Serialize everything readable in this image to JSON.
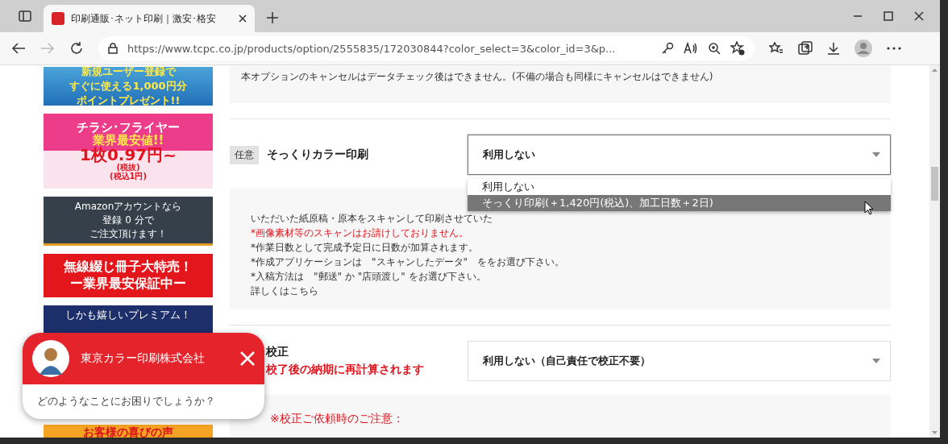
{
  "browser": {
    "tab_title": "印刷通販･ネット印刷｜激安･格安",
    "url": "https://www.tcpc.co.jp/products/option/2555835/172030844?color_select=3&color_id=3&p..."
  },
  "sidebar": {
    "banners": [
      {
        "kind": "points",
        "lines": [
          "新規ユーザー登録で",
          "すぐに使える1,000円分",
          "ポイントプレゼント!!"
        ]
      },
      {
        "kind": "flyer",
        "lines": [
          "チラシ･フライヤー",
          "業界最安値!!",
          "1枚0.97円~",
          "(税抜)",
          "(税込1円)"
        ]
      },
      {
        "kind": "amazon",
        "lines": [
          "Amazonアカウントなら",
          "登録 0 分で",
          "ご注文頂けます！"
        ]
      },
      {
        "kind": "booklet",
        "lines": [
          "無線綴じ冊子大特売！",
          "ー業界最安保証中ー"
        ]
      },
      {
        "kind": "premium",
        "lines": [
          "しかも嬉しいプレミアム！"
        ]
      },
      {
        "kind": "voice",
        "lines": [
          "お客様の喜びの声"
        ]
      }
    ]
  },
  "main": {
    "notice": "本オプションのキャンセルはデータチェック後はできません。(不備の場合も同様にキャンセルはできません)",
    "options": [
      {
        "badge": "任意",
        "label": "そっくりカラー印刷",
        "select": {
          "value": "利用しない",
          "expanded": true,
          "options": [
            {
              "label": "利用しない",
              "highlighted": false
            },
            {
              "label": "そっくり印刷(＋1,420円(税込)、加工日数＋2日)",
              "highlighted": true
            }
          ]
        },
        "notes": [
          {
            "kind": "normal",
            "text": "いただいた紙原稿・原本をスキャンして印刷させていた"
          },
          {
            "kind": "alert",
            "text": "*画像素材等のスキャンはお請けしておりません。"
          },
          {
            "kind": "normal",
            "text": "*作業日数として完成予定日に日数が加算されます。"
          },
          {
            "kind": "normal",
            "text": "*作成アプリケーションは　\"スキャンしたデータ\"　ををお選び下さい。"
          },
          {
            "kind": "normal",
            "text": "*入稿方法は　\"郵送\" か \"店頭渡し\" をお選び下さい。"
          },
          {
            "kind": "normal",
            "text": "詳しくはこちら"
          }
        ]
      },
      {
        "label": "校正",
        "sublabel": "校了後の納期に再計算されます",
        "select": {
          "value": "利用しない（自己責任で校正不要）",
          "expanded": false
        },
        "notes": [
          {
            "kind": "alert",
            "text": "※校正ご依頼時のご注意："
          }
        ]
      }
    ]
  },
  "chat": {
    "company": "東京カラー印刷株式会社",
    "message": "どのようなことにお困りでしょうか？"
  }
}
